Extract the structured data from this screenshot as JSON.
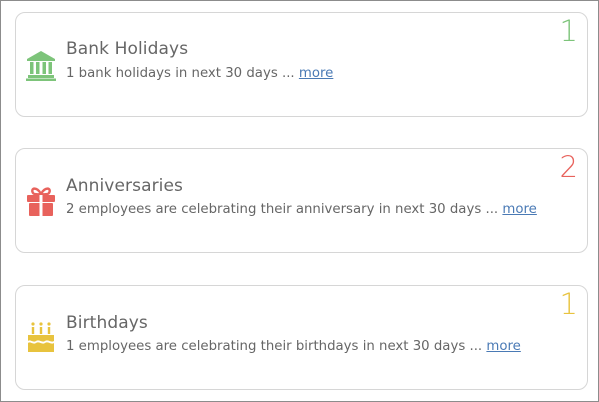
{
  "cards": [
    {
      "title": "Bank Holidays",
      "description": "1 bank holidays in next 30 days ... ",
      "more_label": "more",
      "count": "1",
      "count_color": "#7dc47a",
      "icon": "bank-icon",
      "icon_color": "#7dc47a"
    },
    {
      "title": "Anniversaries",
      "description": "2 employees are celebrating their anniversary in next 30 days ... ",
      "more_label": "more",
      "count": "2",
      "count_color": "#e8625c",
      "icon": "gift-icon",
      "icon_color": "#e8625c"
    },
    {
      "title": "Birthdays",
      "description": "1 employees are celebrating their birthdays in next 30 days ... ",
      "more_label": "more",
      "count": "1",
      "count_color": "#e8c33e",
      "icon": "birthday-cake-icon",
      "icon_color": "#e8c33e"
    }
  ]
}
